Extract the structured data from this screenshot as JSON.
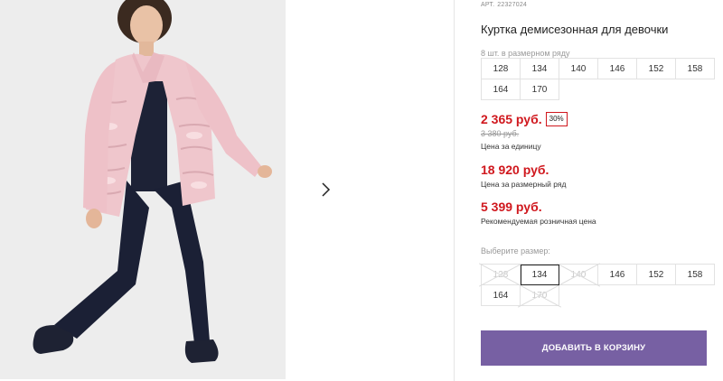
{
  "gallery": {
    "next_icon": "chevron-right-icon"
  },
  "product": {
    "sku_label": "АРТ.",
    "sku_value": "22327024",
    "title": "Куртка демисезонная для девочки",
    "set_note": "8 шт. в размерном ряду",
    "size_set": [
      {
        "label": "128"
      },
      {
        "label": "134"
      },
      {
        "label": "140"
      },
      {
        "label": "146"
      },
      {
        "label": "152"
      },
      {
        "label": "158"
      },
      {
        "label": "164"
      },
      {
        "label": "170"
      }
    ],
    "price_unit": "2 365 руб.",
    "discount": "30%",
    "old_price": "3 380 руб.",
    "price_unit_caption": "Цена за единицу",
    "price_set": "18 920 руб.",
    "price_set_caption": "Цена за размерный ряд",
    "price_retail": "5 399 руб.",
    "price_retail_caption": "Рекомендуемая розничная цена",
    "choose_label": "Выберите размер:",
    "size_select": [
      {
        "label": "128",
        "state": "disabled"
      },
      {
        "label": "134",
        "state": "selected"
      },
      {
        "label": "140",
        "state": "disabled"
      },
      {
        "label": "146",
        "state": "available"
      },
      {
        "label": "152",
        "state": "available"
      },
      {
        "label": "158",
        "state": "available"
      },
      {
        "label": "164",
        "state": "available"
      },
      {
        "label": "170",
        "state": "disabled"
      }
    ],
    "add_to_cart": "ДОБАВИТЬ В КОРЗИНУ"
  },
  "colors": {
    "price_red": "#d0181e",
    "button_purple": "#7760a3"
  }
}
